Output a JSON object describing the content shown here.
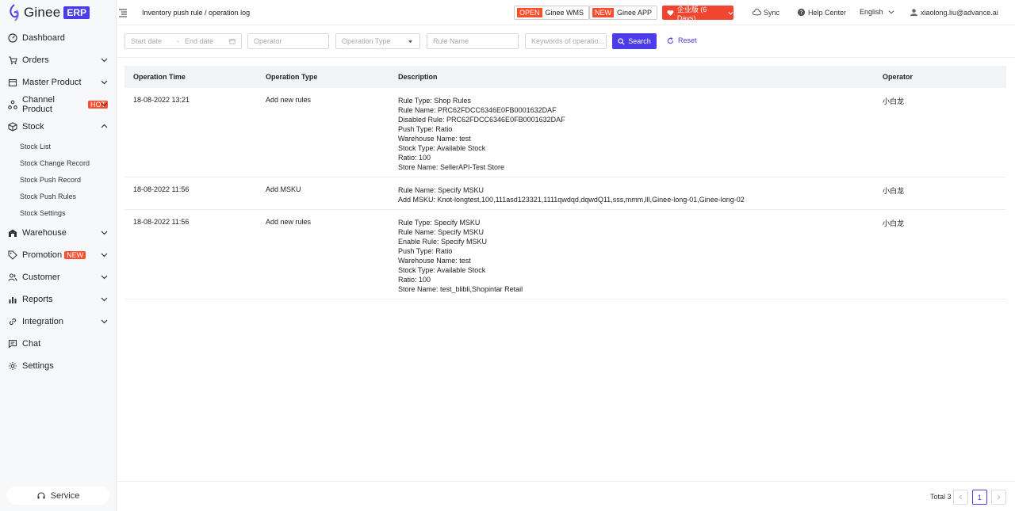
{
  "brand": {
    "name": "Ginee",
    "tag": "ERP"
  },
  "sidebar": {
    "items": [
      {
        "label": "Dashboard"
      },
      {
        "label": "Orders"
      },
      {
        "label": "Master Product"
      },
      {
        "label": "Channel Product",
        "badge": "HOT"
      },
      {
        "label": "Stock"
      },
      {
        "label": "Warehouse"
      },
      {
        "label": "Promotion",
        "badge": "NEW"
      },
      {
        "label": "Customer"
      },
      {
        "label": "Reports"
      },
      {
        "label": "Integration"
      },
      {
        "label": "Chat"
      },
      {
        "label": "Settings"
      }
    ],
    "stock_sub": [
      "Stock List",
      "Stock Change Record",
      "Stock Push Record",
      "Stock Push Rules",
      "Stock Settings"
    ],
    "service": "Service"
  },
  "header": {
    "breadcrumb": "Inventory push rule / operation log",
    "wms": {
      "tag": "OPEN",
      "label": "Ginee WMS"
    },
    "app": {
      "tag": "NEW",
      "label": "Ginee APP"
    },
    "enterprise": "企业版 (6 Days)",
    "sync": "Sync",
    "help": "Help Center",
    "language": "English",
    "user": "xiaolong.liu@advance.ai"
  },
  "filters": {
    "start_date": "Start date",
    "end_date": "End date",
    "operator": "Operator",
    "operation_type": "Operation Type",
    "rule_name": "Rule Name",
    "keywords": "Keywords of operatio...",
    "search": "Search",
    "reset": "Reset"
  },
  "table": {
    "headers": [
      "Operation Time",
      "Operation Type",
      "Description",
      "Operator"
    ],
    "rows": [
      {
        "time": "18-08-2022 13:21",
        "type": "Add new rules",
        "desc": [
          "Rule Type: Shop Rules",
          "Rule Name: PRC62FDCC6346E0FB0001632DAF",
          "Disabled Rule: PRC62FDCC6346E0FB0001632DAF",
          "Push Type: Ratio",
          "Warehouse Name: test",
          "Stock Type: Available Stock",
          "Ratio: 100",
          "Store Name: SellerAPI-Test Store"
        ],
        "operator": "小白龙"
      },
      {
        "time": "18-08-2022 11:56",
        "type": "Add MSKU",
        "desc": [
          "Rule Name: Specify MSKU",
          "Add MSKU: Knot-longtest,100,111asd123321,1111qwdqd,dqwdQ11,sss,mmm,lll,Ginee-long-01,Ginee-long-02"
        ],
        "operator": "小白龙"
      },
      {
        "time": "18-08-2022 11:56",
        "type": "Add new rules",
        "desc": [
          "Rule Type: Specify MSKU",
          "Rule Name: Specify MSKU",
          "Enable Rule: Specify MSKU",
          "Push Type: Ratio",
          "Warehouse Name: test",
          "Stock Type: Available Stock",
          "Ratio: 100",
          "Store Name: test_blibli,Shopintar Retail"
        ],
        "operator": "小白龙"
      }
    ]
  },
  "pagination": {
    "total": "Total 3",
    "page": "1"
  },
  "colors": {
    "accent": "#4b3be8",
    "danger": "#f2452f"
  }
}
